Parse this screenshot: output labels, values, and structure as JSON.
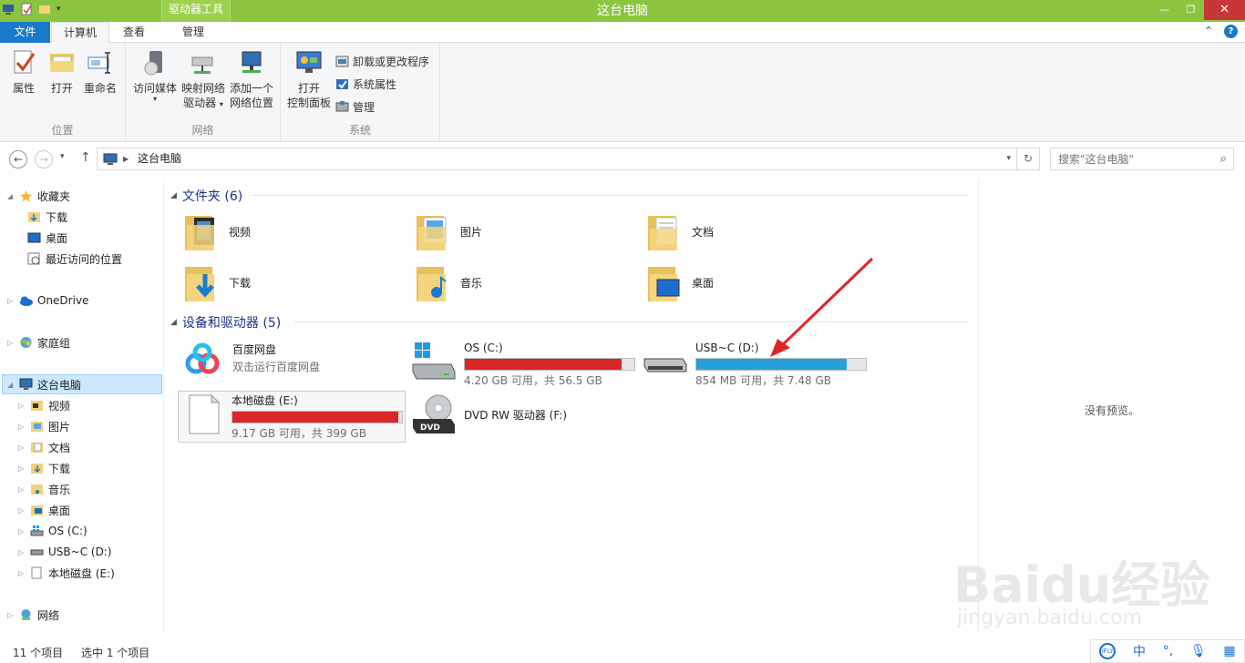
{
  "window": {
    "title": "这台电脑",
    "context_tab": "驱动器工具"
  },
  "tabs": {
    "file": "文件",
    "computer": "计算机",
    "view": "查看",
    "manage": "管理"
  },
  "ribbon": {
    "location": {
      "name": "位置",
      "properties": "属性",
      "open": "打开",
      "rename": "重命名"
    },
    "network": {
      "name": "网络",
      "access_media": "访问媒体",
      "map_drive_1": "映射网络",
      "map_drive_2": "驱动器",
      "add_location_1": "添加一个",
      "add_location_2": "网络位置"
    },
    "system": {
      "name": "系统",
      "control_panel_1": "打开",
      "control_panel_2": "控制面板",
      "uninstall": "卸载或更改程序",
      "sys_props": "系统属性",
      "manage": "管理"
    }
  },
  "address": {
    "path": "这台电脑",
    "search_placeholder": "搜索\"这台电脑\""
  },
  "nav": {
    "favorites": "收藏夹",
    "downloads": "下载",
    "desktop": "桌面",
    "recent": "最近访问的位置",
    "onedrive": "OneDrive",
    "homegroup": "家庭组",
    "this_pc": "这台电脑",
    "pc_items": [
      "视频",
      "图片",
      "文档",
      "下载",
      "音乐",
      "桌面",
      "OS (C:)",
      "USB~C (D:)",
      "本地磁盘 (E:)"
    ],
    "network": "网络"
  },
  "folders": {
    "header": "文件夹 (6)",
    "items": [
      "视频",
      "图片",
      "文档",
      "下载",
      "音乐",
      "桌面"
    ]
  },
  "devices": {
    "header": "设备和驱动器 (5)",
    "baidu": {
      "name": "百度网盘",
      "sub": "双击运行百度网盘"
    },
    "c": {
      "name": "OS (C:)",
      "sub": "4.20 GB 可用，共 56.5 GB",
      "used_pct": 92.6
    },
    "d": {
      "name": "USB~C (D:)",
      "sub": "854 MB 可用，共 7.48 GB",
      "used_pct": 88.9
    },
    "e": {
      "name": "本地磁盘 (E:)",
      "sub": "9.17 GB 可用，共 399 GB",
      "used_pct": 97.7
    },
    "f": {
      "name": "DVD RW 驱动器 (F:)"
    }
  },
  "preview": {
    "text": "没有预览。"
  },
  "status": {
    "count": "11 个项目",
    "selected": "选中 1 个项目"
  },
  "ime": {
    "lang": "中"
  },
  "watermark": {
    "brand": "Baidu经验",
    "url": "jingyan.baidu.com"
  },
  "colors": {
    "titlebar": "#8bc53f",
    "file_tab": "#1979ca",
    "bar_red": "#da2626",
    "bar_blue": "#26a0da",
    "arrow": "#e32424"
  }
}
